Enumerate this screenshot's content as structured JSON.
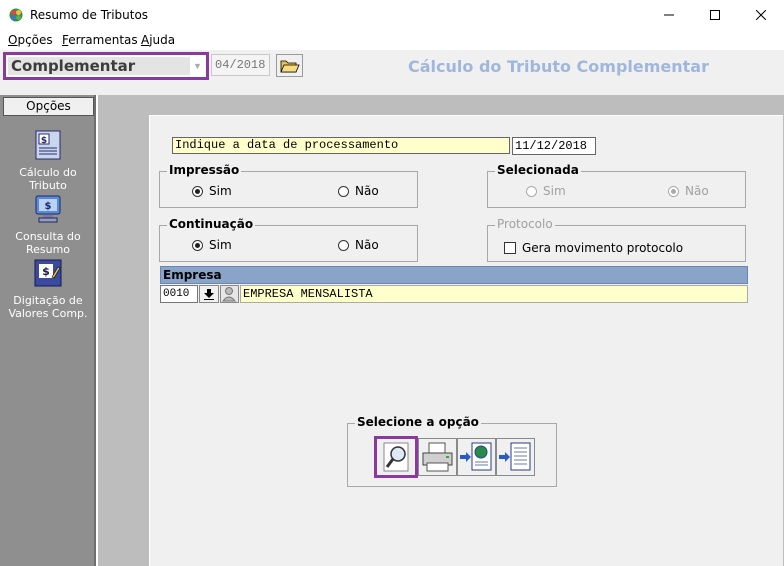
{
  "window": {
    "title": "Resumo de Tributos",
    "minimize": "—",
    "maximize": "☐",
    "close": "✕"
  },
  "menu": {
    "items": [
      {
        "accel": "O",
        "rest": "pções"
      },
      {
        "accel": "F",
        "rest": "erramentas"
      },
      {
        "accel": "A",
        "rest": "juda"
      }
    ]
  },
  "toolbar": {
    "type_value": "Complementar",
    "period_value": "04/2018",
    "screen_title": "Cálculo do Tributo Complementar"
  },
  "sidebar": {
    "header": "Opções",
    "items": [
      {
        "line1": "Cálculo do",
        "line2": "Tributo",
        "icon": "calc-document-icon"
      },
      {
        "line1": "Consulta do",
        "line2": "Resumo",
        "icon": "monitor-dollar-icon"
      },
      {
        "line1": "Digitação de",
        "line2": "Valores Comp.",
        "icon": "edit-dollar-icon"
      }
    ]
  },
  "form": {
    "process_label": "Indique a data de processamento",
    "process_date": "11/12/2018",
    "impressao": {
      "title": "Impressão",
      "sim": "Sim",
      "nao": "Não",
      "selected": "Sim"
    },
    "selecionada": {
      "title": "Selecionada",
      "sim": "Sim",
      "nao": "Não",
      "selected": "Não"
    },
    "continuacao": {
      "title": "Continuação",
      "sim": "Sim",
      "nao": "Não",
      "selected": "Sim"
    },
    "protocolo": {
      "title": "Protocolo",
      "checkbox_label": "Gera movimento protocolo",
      "checked": false
    },
    "empresa": {
      "header": "Empresa",
      "code": "0010",
      "name": "EMPRESA MENSALISTA"
    },
    "options": {
      "title": "Selecione a opção"
    }
  },
  "colors": {
    "accent_highlight": "#8a3a9c",
    "title_blue": "#9fb7dd",
    "grid_header": "#8aa3c9",
    "yellow_field": "#ffffcc"
  }
}
